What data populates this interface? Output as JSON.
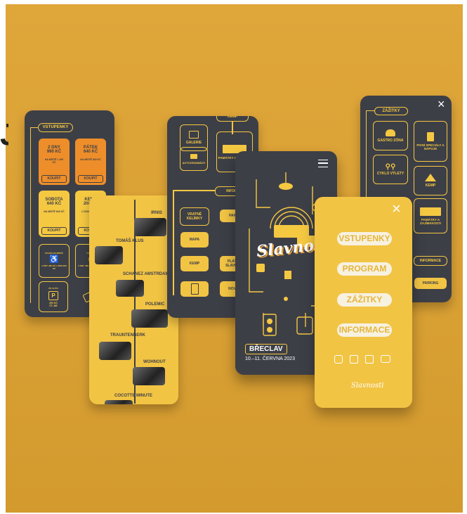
{
  "tickets": {
    "header": "VSTUPENKY",
    "cards": [
      {
        "title": "2 DNY",
        "price": "990 KČ",
        "note": "NA MÍSTĚ 1 190 KČ",
        "button": "KOUPIT"
      },
      {
        "title": "PÁTEK",
        "price": "640 KČ",
        "note": "NA MÍSTĚ 840 KČ",
        "button": "KOUPIT"
      },
      {
        "title": "SOBOTA",
        "price": "640 KČ",
        "note": "NA MÍSTĚ 840 KČ",
        "button": "KOUPIT"
      },
      {
        "title": "KEMP",
        "price": "200 KČ",
        "note": "1 OSOBA / NOC",
        "button": "KOUPIT"
      }
    ],
    "info": [
      {
        "label": "POUZE NA MÍSTĚ",
        "text": "2 DNY 480 KČ 1 DEN 299 KČ"
      },
      {
        "label": "T-SHIRT",
        "text": "2 DNY 480 KČ 1 DEN 299 KČ"
      }
    ],
    "parking": {
      "label": "PK AUTO",
      "price": "200 KČ",
      "note": "ČT–NE"
    }
  },
  "lineup": {
    "artists": [
      "IRNIS",
      "TOMÁŠ KLUS",
      "SCHANEZ AMSTRDAM",
      "POLEMIC",
      "TRAUNTENBERK",
      "WOHNOUT",
      "COCOTTE MINUTE"
    ]
  },
  "map": {
    "top": "KEMP",
    "items": [
      "GALERIE",
      "PAMÁTKY A ZAJÍMAV",
      "AUTOGRAMIÁDY",
      "INFORM",
      "VRATNÉ KELÍMKY",
      "PARK",
      "MAPA",
      "KEMP",
      "PLATIM SLAVNOS",
      "NOVIN"
    ]
  },
  "main": {
    "logo": "Slavnosti",
    "city": "BŘECLAV",
    "date": "10.–11. ČERVNA 2023"
  },
  "menu": {
    "items": [
      "VSTUPENKY",
      "PROGRAM",
      "ZÁŽITKY",
      "INFORMACE"
    ],
    "close": "×",
    "logo": "Slavnosti"
  },
  "experiences": {
    "header": "ZÁŽITKY",
    "close": "×",
    "items": [
      "GASTRO ZÓNA",
      "PIVNÍ SPECIÁLY A NÁPOJE",
      "CYKLO VÝLETY",
      "KEMP",
      "PAMÁTKY A ZAJÍMAVOSTI"
    ],
    "info": "INFORMACE",
    "parking": "PARKING"
  },
  "edge_glyph": "J"
}
